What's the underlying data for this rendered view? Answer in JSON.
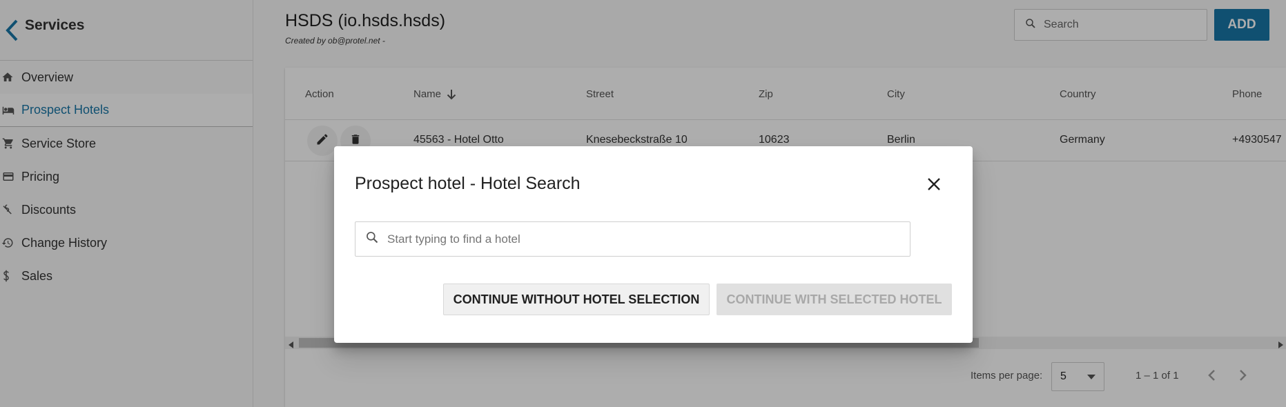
{
  "sidebar": {
    "title": "Services",
    "items": [
      {
        "label": "Overview",
        "icon": "home-icon"
      },
      {
        "label": "Prospect Hotels",
        "icon": "bed-icon",
        "active": true
      },
      {
        "label": "Service Store",
        "icon": "cart-icon"
      },
      {
        "label": "Pricing",
        "icon": "credit-card-icon"
      },
      {
        "label": "Discounts",
        "icon": "discount-icon"
      },
      {
        "label": "Change History",
        "icon": "history-icon"
      },
      {
        "label": "Sales",
        "icon": "dollar-icon"
      }
    ]
  },
  "header": {
    "title": "HSDS (io.hsds.hsds)",
    "subtitle": "Created by ob@protel.net -",
    "search_placeholder": "Search",
    "add_label": "ADD"
  },
  "table": {
    "columns": [
      "Action",
      "Name",
      "Street",
      "Zip",
      "City",
      "Country",
      "Phone"
    ],
    "rows": [
      {
        "name": "45563 - Hotel Otto",
        "street": "Knesebeckstraße 10",
        "zip": "10623",
        "city": "Berlin",
        "country": "Germany",
        "phone": "+4930547"
      }
    ],
    "sort_column": "Name",
    "sort_direction": "desc"
  },
  "pagination": {
    "items_per_page_label": "Items per page:",
    "items_per_page": "5",
    "range": "1 – 1 of 1"
  },
  "dialog": {
    "title": "Prospect hotel - Hotel Search",
    "search_placeholder": "Start typing to find a hotel",
    "continue_without_label": "CONTINUE WITHOUT HOTEL SELECTION",
    "continue_with_label": "CONTINUE WITH SELECTED HOTEL"
  },
  "colors": {
    "accent": "#1976a7",
    "overlay": "rgba(0,0,0,0.32)"
  }
}
